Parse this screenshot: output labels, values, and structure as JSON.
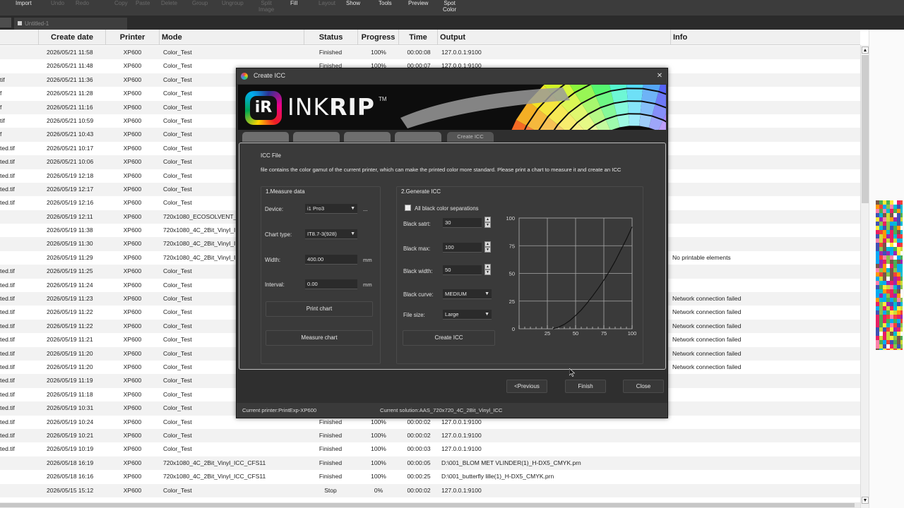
{
  "toolbar": {
    "items": [
      {
        "label": "Import",
        "active": true
      },
      {
        "label": "Undo",
        "active": false
      },
      {
        "label": "Redo",
        "active": false
      },
      {
        "label": "Copy",
        "active": false
      },
      {
        "label": "Paste",
        "active": false
      },
      {
        "label": "Delete",
        "active": false
      },
      {
        "label": "Group",
        "active": false
      },
      {
        "label": "Ungroup",
        "active": false
      },
      {
        "label": "Split\nImage",
        "active": false
      },
      {
        "label": "Fill",
        "active": true
      },
      {
        "label": "Layout",
        "active": false
      },
      {
        "label": "Show",
        "active": true
      },
      {
        "label": "Tools",
        "active": true
      },
      {
        "label": "Preview",
        "active": true
      },
      {
        "label": "Spot\nColor",
        "active": true
      }
    ]
  },
  "doc_tab": {
    "label": "Untitled-1"
  },
  "table": {
    "headers": {
      "create_date": "Create date",
      "printer": "Printer",
      "mode": "Mode",
      "status": "Status",
      "progress": "Progress",
      "time": "Time",
      "output": "Output",
      "info": "Info"
    },
    "rows": [
      {
        "file": "",
        "date": "2026/05/21 11:58",
        "printer": "XP600",
        "mode": "Color_Test",
        "status": "Finished",
        "progress": "100%",
        "time": "00:00:08",
        "output": "127.0.0.1:9100",
        "info": ""
      },
      {
        "file": "",
        "date": "2026/05/21 11:48",
        "printer": "XP600",
        "mode": "Color_Test",
        "status": "Finished",
        "progress": "100%",
        "time": "00:00:07",
        "output": "127.0.0.1:9100",
        "info": ""
      },
      {
        "file": "tif",
        "date": "2026/05/21 11:36",
        "printer": "XP600",
        "mode": "Color_Test",
        "status": "",
        "progress": "",
        "time": "",
        "output": "",
        "info": ""
      },
      {
        "file": "f",
        "date": "2026/05/21 11:28",
        "printer": "XP600",
        "mode": "Color_Test",
        "status": "",
        "progress": "",
        "time": "",
        "output": "",
        "info": ""
      },
      {
        "file": "f",
        "date": "2026/05/21 11:16",
        "printer": "XP600",
        "mode": "Color_Test",
        "status": "",
        "progress": "",
        "time": "",
        "output": "",
        "info": ""
      },
      {
        "file": "tif",
        "date": "2026/05/21 10:59",
        "printer": "XP600",
        "mode": "Color_Test",
        "status": "",
        "progress": "",
        "time": "",
        "output": "",
        "info": ""
      },
      {
        "file": "f",
        "date": "2026/05/21 10:43",
        "printer": "XP600",
        "mode": "Color_Test",
        "status": "",
        "progress": "",
        "time": "",
        "output": "",
        "info": ""
      },
      {
        "file": "ted.tif",
        "date": "2026/05/21 10:17",
        "printer": "XP600",
        "mode": "Color_Test",
        "status": "",
        "progress": "",
        "time": "",
        "output": "",
        "info": ""
      },
      {
        "file": "ted.tif",
        "date": "2026/05/21 10:06",
        "printer": "XP600",
        "mode": "Color_Test",
        "status": "",
        "progress": "",
        "time": "",
        "output": "",
        "info": ""
      },
      {
        "file": "ted.tif",
        "date": "2026/05/19 12:18",
        "printer": "XP600",
        "mode": "Color_Test",
        "status": "",
        "progress": "",
        "time": "",
        "output": "",
        "info": ""
      },
      {
        "file": "ted.tif",
        "date": "2026/05/19 12:17",
        "printer": "XP600",
        "mode": "Color_Test",
        "status": "",
        "progress": "",
        "time": "",
        "output": "",
        "info": ""
      },
      {
        "file": "ted.tif",
        "date": "2026/05/19 12:16",
        "printer": "XP600",
        "mode": "Color_Test",
        "status": "",
        "progress": "",
        "time": "",
        "output": "",
        "info": ""
      },
      {
        "file": "",
        "date": "2026/05/19 12:11",
        "printer": "XP600",
        "mode": "720x1080_ECOSOLVENT_2",
        "status": "",
        "progress": "",
        "time": "",
        "output": "",
        "info": ""
      },
      {
        "file": "",
        "date": "2026/05/19 11:38",
        "printer": "XP600",
        "mode": "720x1080_4C_2Bit_Vinyl_I",
        "status": "",
        "progress": "",
        "time": "",
        "output": "",
        "info": ""
      },
      {
        "file": "",
        "date": "2026/05/19 11:30",
        "printer": "XP600",
        "mode": "720x1080_4C_2Bit_Vinyl_I",
        "status": "",
        "progress": "",
        "time": "",
        "output": "",
        "info": ""
      },
      {
        "file": "",
        "date": "2026/05/19 11:29",
        "printer": "XP600",
        "mode": "720x1080_4C_2Bit_Vinyl_I",
        "status": "",
        "progress": "",
        "time": "",
        "output": "",
        "info": "No printable elements"
      },
      {
        "file": "ted.tif",
        "date": "2026/05/19 11:25",
        "printer": "XP600",
        "mode": "Color_Test",
        "status": "",
        "progress": "",
        "time": "",
        "output": "",
        "info": ""
      },
      {
        "file": "ted.tif",
        "date": "2026/05/19 11:24",
        "printer": "XP600",
        "mode": "Color_Test",
        "status": "",
        "progress": "",
        "time": "",
        "output": "",
        "info": ""
      },
      {
        "file": "ted.tif",
        "date": "2026/05/19 11:23",
        "printer": "XP600",
        "mode": "Color_Test",
        "status": "",
        "progress": "",
        "time": "",
        "output": "",
        "info": "Network connection failed"
      },
      {
        "file": "ted.tif",
        "date": "2026/05/19 11:22",
        "printer": "XP600",
        "mode": "Color_Test",
        "status": "",
        "progress": "",
        "time": "",
        "output": "",
        "info": "Network connection failed"
      },
      {
        "file": "ted.tif",
        "date": "2026/05/19 11:22",
        "printer": "XP600",
        "mode": "Color_Test",
        "status": "",
        "progress": "",
        "time": "",
        "output": "",
        "info": "Network connection failed"
      },
      {
        "file": "ted.tif",
        "date": "2026/05/19 11:21",
        "printer": "XP600",
        "mode": "Color_Test",
        "status": "",
        "progress": "",
        "time": "",
        "output": "",
        "info": "Network connection failed"
      },
      {
        "file": "ted.tif",
        "date": "2026/05/19 11:20",
        "printer": "XP600",
        "mode": "Color_Test",
        "status": "",
        "progress": "",
        "time": "",
        "output": "",
        "info": "Network connection failed"
      },
      {
        "file": "ted.tif",
        "date": "2026/05/19 11:20",
        "printer": "XP600",
        "mode": "Color_Test",
        "status": "",
        "progress": "",
        "time": "",
        "output": "",
        "info": "Network connection failed"
      },
      {
        "file": "ted.tif",
        "date": "2026/05/19 11:19",
        "printer": "XP600",
        "mode": "Color_Test",
        "status": "",
        "progress": "",
        "time": "",
        "output": "",
        "info": ""
      },
      {
        "file": "ted.tif",
        "date": "2026/05/19 11:18",
        "printer": "XP600",
        "mode": "Color_Test",
        "status": "",
        "progress": "",
        "time": "",
        "output": "",
        "info": ""
      },
      {
        "file": "ted.tif",
        "date": "2026/05/19 10:31",
        "printer": "XP600",
        "mode": "Color_Test",
        "status": "",
        "progress": "",
        "time": "",
        "output": "",
        "info": ""
      },
      {
        "file": "ted.tif",
        "date": "2026/05/19 10:24",
        "printer": "XP600",
        "mode": "Color_Test",
        "status": "Finished",
        "progress": "100%",
        "time": "00:00:02",
        "output": "127.0.0.1:9100",
        "info": ""
      },
      {
        "file": "ted.tif",
        "date": "2026/05/19 10:21",
        "printer": "XP600",
        "mode": "Color_Test",
        "status": "Finished",
        "progress": "100%",
        "time": "00:00:02",
        "output": "127.0.0.1:9100",
        "info": ""
      },
      {
        "file": "ted.tif",
        "date": "2026/05/19 10:19",
        "printer": "XP600",
        "mode": "Color_Test",
        "status": "Finished",
        "progress": "100%",
        "time": "00:00:03",
        "output": "127.0.0.1:9100",
        "info": ""
      },
      {
        "file": "",
        "date": "2026/05/18 16:19",
        "printer": "XP600",
        "mode": "720x1080_4C_2Bit_Vinyl_ICC_CFS11",
        "status": "Finished",
        "progress": "100%",
        "time": "00:00:05",
        "output": "D:\\001_BLOM MET VLINDER(1)_H-DX5_CMYK.prn",
        "info": ""
      },
      {
        "file": "",
        "date": "2026/05/18 16:16",
        "printer": "XP600",
        "mode": "720x1080_4C_2Bit_Vinyl_ICC_CFS11",
        "status": "Finished",
        "progress": "100%",
        "time": "00:00:25",
        "output": "D:\\001_butterfly lille(1)_H-DX5_CMYK.prn",
        "info": ""
      },
      {
        "file": "",
        "date": "2026/05/15 15:12",
        "printer": "XP600",
        "mode": "Color_Test",
        "status": "Stop",
        "progress": "0%",
        "time": "00:00:02",
        "output": "127.0.0.1:9100",
        "info": ""
      }
    ]
  },
  "dialog": {
    "title": "Create ICC",
    "logo_mark": "iR",
    "logo_ink": "INK",
    "logo_rip": "RIP",
    "logo_tm": "TM",
    "step_tabs": [
      "",
      "",
      "",
      "",
      "Create ICC"
    ],
    "active_step": 4,
    "icc_file_title": "ICC File",
    "description": "file contains the color gamut of the current printer, which can make the printed color more standard. Please print a chart to measure it and create an ICC",
    "measure": {
      "title": "1.Measure data",
      "device_label": "Device:",
      "device_value": "i1 Pro3",
      "browse_label": "...",
      "chart_type_label": "Chart type:",
      "chart_type_value": "IT8.7-3(928)",
      "width_label": "Width:",
      "width_value": "400.00",
      "width_unit": "mm",
      "interval_label": "Interval:",
      "interval_value": "0.00",
      "interval_unit": "mm",
      "print_chart": "Print chart",
      "measure_chart": "Measure chart"
    },
    "generate": {
      "title": "2.Generate ICC",
      "all_black_label": "All black color separations",
      "all_black_checked": false,
      "black_start_label": "Black satrt:",
      "black_start_value": "30",
      "black_max_label": "Black max:",
      "black_max_value": "100",
      "black_width_label": "Black width:",
      "black_width_value": "50",
      "black_curve_label": "Black curve:",
      "black_curve_value": "MEDIUM",
      "file_size_label": "File size:",
      "file_size_value": "Large",
      "create_icc": "Create ICC"
    },
    "chart_data": {
      "type": "line",
      "x": [
        30,
        35,
        40,
        45,
        50,
        55,
        60,
        65,
        70,
        75,
        80,
        85,
        90,
        95,
        100
      ],
      "series": [
        {
          "values": [
            0,
            1.5,
            4,
            7.5,
            12,
            17,
            23,
            29.5,
            36.5,
            44,
            52,
            61,
            71,
            81,
            92
          ]
        }
      ],
      "xlim": [
        0,
        100
      ],
      "ylim": [
        0,
        100
      ],
      "x_ticks": [
        "25",
        "50",
        "75",
        "100"
      ],
      "y_ticks": [
        "0",
        "25",
        "50",
        "75",
        "100"
      ],
      "grid": true,
      "title": "",
      "xlabel": "",
      "ylabel": ""
    },
    "nav": {
      "previous": "<Previous",
      "finish": "Finish",
      "close": "Close"
    },
    "status": {
      "current_printer": "Current printer:PrintExp-XP600",
      "current_solution": "Current solution:AAS_720x720_4C_2Bit_Vinyl_ICC"
    }
  },
  "colors": {
    "toolbar_bg": "#3c3c3c",
    "dialog_bg": "#2f2f2f",
    "panel_bg": "#3a3a3a",
    "curve": "#111111"
  }
}
